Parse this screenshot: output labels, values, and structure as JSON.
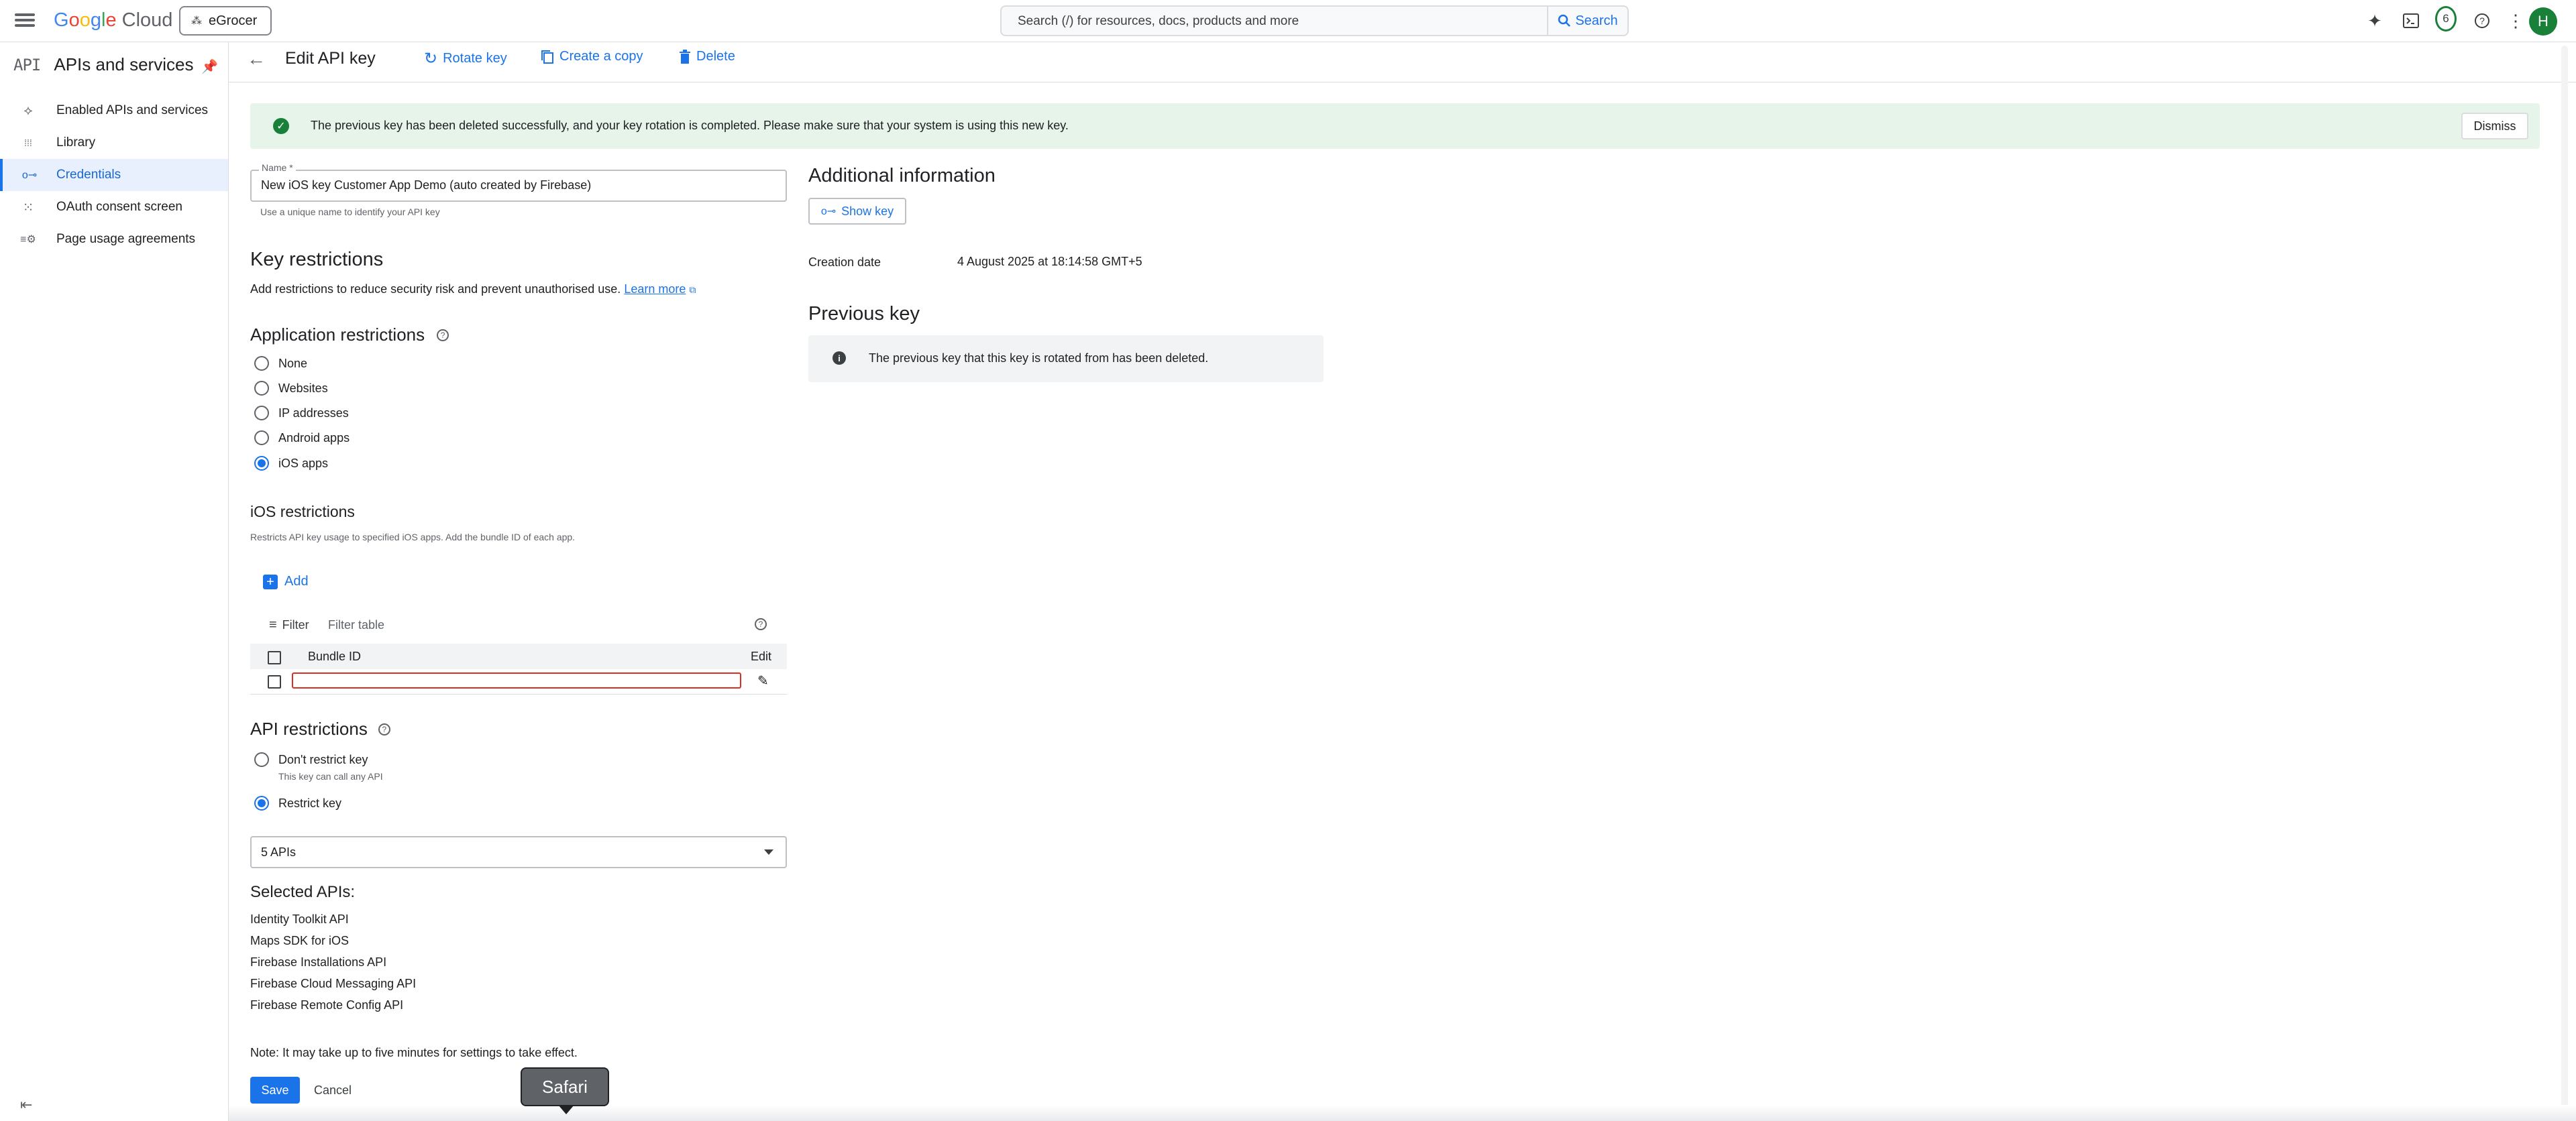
{
  "topbar": {
    "brand": [
      "G",
      "o",
      "o",
      "g",
      "l",
      "e"
    ],
    "brand_suffix": " Cloud",
    "project": "eGrocer",
    "search_placeholder": "Search (/) for resources, docs, products and more",
    "search_button": "Search",
    "notification_count": "6",
    "avatar_initial": "H"
  },
  "sidebar": {
    "api_glyph": "API",
    "title": "APIs and services",
    "items": [
      {
        "label": "Enabled APIs and services",
        "icon": "hub-icon",
        "glyph": "⟡"
      },
      {
        "label": "Library",
        "icon": "grid-icon",
        "glyph": "⁞⁞⁞"
      },
      {
        "label": "Credentials",
        "icon": "key-icon",
        "glyph": "o⊸"
      },
      {
        "label": "OAuth consent screen",
        "icon": "consent-icon",
        "glyph": "⁙"
      },
      {
        "label": "Page usage agreements",
        "icon": "settings-list-icon",
        "glyph": "≡⚙"
      }
    ],
    "active_index": 2
  },
  "header": {
    "title": "Edit API key",
    "rotate": "Rotate key",
    "copy": "Create a copy",
    "delete": "Delete"
  },
  "banner": {
    "message": "The previous key has been deleted successfully, and your key rotation is completed. Please make sure that your system is using this new key.",
    "dismiss": "Dismiss"
  },
  "form": {
    "name_label": "Name *",
    "name_value": "New iOS key Customer App Demo (auto created by Firebase)",
    "name_help": "Use a unique name to identify your API key",
    "key_restrictions_title": "Key restrictions",
    "key_restrictions_desc": "Add restrictions to reduce security risk and prevent unauthorised use.",
    "learn_more": "Learn more",
    "app_restrictions_title": "Application restrictions",
    "app_restrictions": [
      "None",
      "Websites",
      "IP addresses",
      "Android apps",
      "iOS apps"
    ],
    "app_selected_index": 4,
    "ios_title": "iOS restrictions",
    "ios_desc": "Restricts API key usage to specified iOS apps. Add the bundle ID of each app.",
    "add": "Add",
    "filter_label": "Filter",
    "filter_placeholder": "Filter table",
    "col_bundle": "Bundle ID",
    "col_edit": "Edit",
    "bundle_value": "",
    "api_restrictions_title": "API restrictions",
    "dont_restrict": "Don't restrict key",
    "dont_restrict_sub": "This key can call any API",
    "restrict": "Restrict key",
    "api_selected_option": "restrict",
    "api_select_value": "5 APIs",
    "selected_apis_title": "Selected APIs:",
    "selected_apis": [
      "Identity Toolkit API",
      "Maps SDK for iOS",
      "Firebase Installations API",
      "Firebase Cloud Messaging API",
      "Firebase Remote Config API"
    ],
    "note": "Note: It may take up to five minutes for settings to take effect.",
    "save": "Save",
    "cancel": "Cancel"
  },
  "info": {
    "title": "Additional information",
    "show_key": "Show key",
    "creation_label": "Creation date",
    "creation_value": "4 August 2025 at 18:14:58 GMT+5",
    "prev_title": "Previous key",
    "prev_message": "The previous key that this key is rotated from has been deleted."
  },
  "tooltip": {
    "label": "Safari"
  },
  "colors": {
    "accent": "#1a73e8",
    "success_bg": "#e6f4ea",
    "success": "#188038",
    "error": "#d93025"
  }
}
